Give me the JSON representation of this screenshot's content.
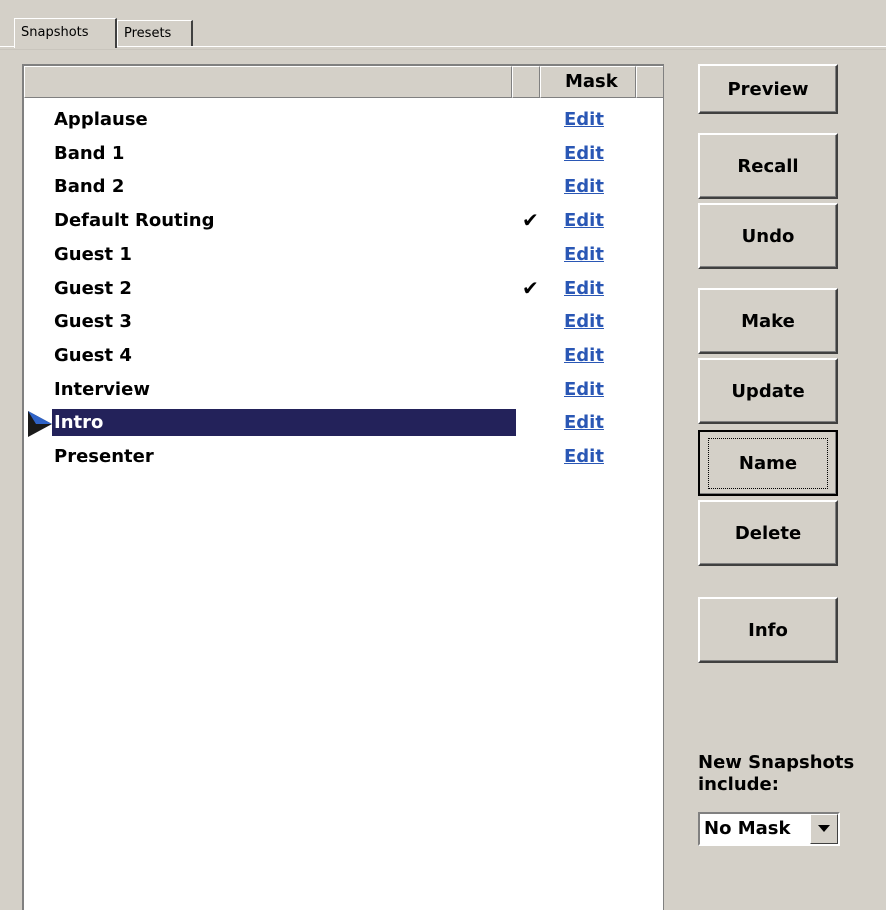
{
  "tabs": [
    {
      "label": "Snapshots",
      "active": true
    },
    {
      "label": "Presets",
      "active": false
    }
  ],
  "list": {
    "header": {
      "mask": "Mask"
    },
    "edit_label": "Edit",
    "rows": [
      {
        "name": "Applause",
        "checked": false,
        "selected": false
      },
      {
        "name": "Band 1",
        "checked": false,
        "selected": false
      },
      {
        "name": "Band 2",
        "checked": false,
        "selected": false
      },
      {
        "name": "Default Routing",
        "checked": true,
        "selected": false
      },
      {
        "name": "Guest 1",
        "checked": false,
        "selected": false
      },
      {
        "name": "Guest 2",
        "checked": true,
        "selected": false
      },
      {
        "name": "Guest 3",
        "checked": false,
        "selected": false
      },
      {
        "name": "Guest 4",
        "checked": false,
        "selected": false
      },
      {
        "name": "Interview",
        "checked": false,
        "selected": false
      },
      {
        "name": "Intro",
        "checked": false,
        "selected": true
      },
      {
        "name": "Presenter",
        "checked": false,
        "selected": false
      }
    ],
    "check_glyph": "✔",
    "selection_color": "#23225a",
    "link_color": "#2a57b5"
  },
  "buttons": {
    "preview": "Preview",
    "recall": "Recall",
    "undo": "Undo",
    "make": "Make",
    "update": "Update",
    "name": "Name",
    "delete": "Delete",
    "info": "Info"
  },
  "new_snapshots": {
    "label": "New Snapshots include:",
    "selected": "No Mask"
  }
}
